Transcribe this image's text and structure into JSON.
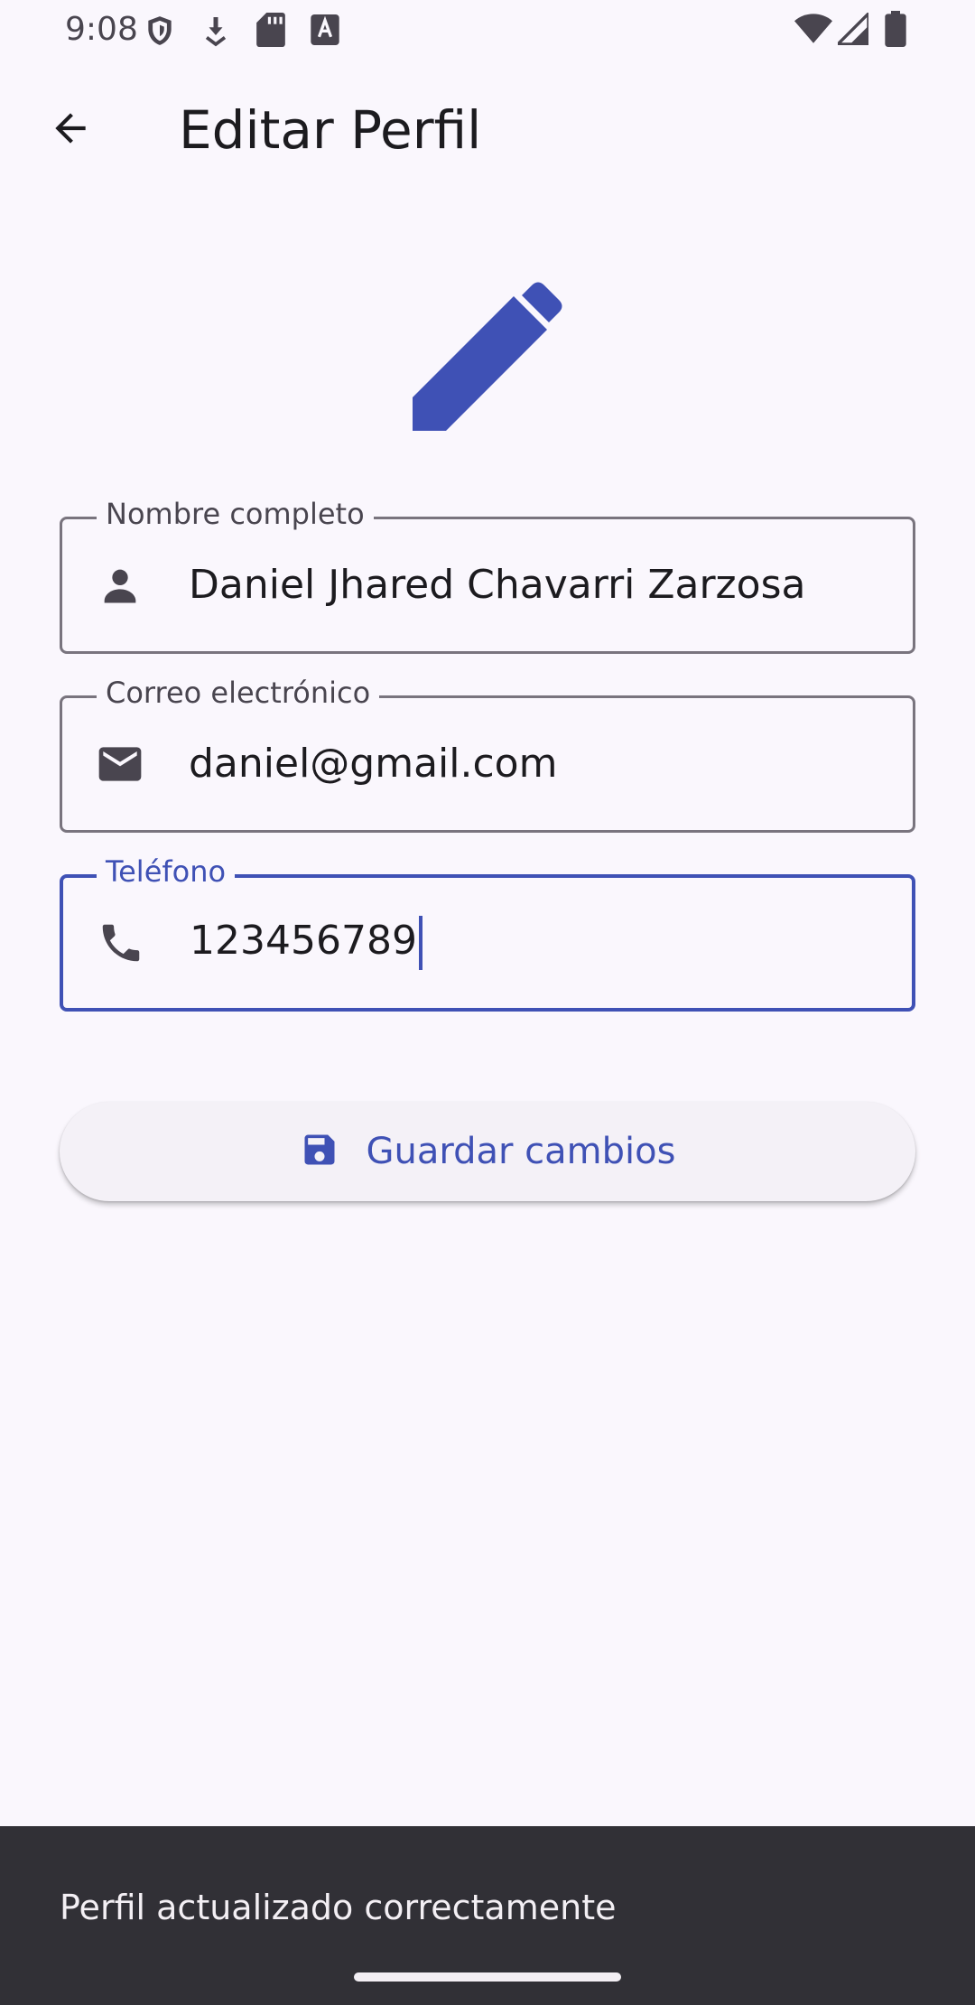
{
  "status_bar": {
    "time": "9:08",
    "left_icons": [
      "shield-icon",
      "download-icon",
      "sd-card-icon",
      "a-badge-icon"
    ],
    "right_icons": [
      "wifi-icon",
      "signal-icon",
      "battery-icon"
    ]
  },
  "app_bar": {
    "back_icon": "arrow-back-icon",
    "title": "Editar Perfil"
  },
  "header_icon": "edit-pencil-icon",
  "accent_color": "#3f51b5",
  "form": {
    "name": {
      "label": "Nombre completo",
      "value": "Daniel Jhared Chavarri Zarzosa",
      "icon": "person-icon"
    },
    "email": {
      "label": "Correo electrónico",
      "value": "daniel@gmail.com",
      "icon": "mail-icon"
    },
    "phone": {
      "label": "Teléfono",
      "value": "123456789",
      "icon": "phone-icon",
      "focused": true
    }
  },
  "save_button": {
    "label": "Guardar cambios",
    "icon": "save-icon"
  },
  "snackbar": {
    "message": "Perfil actualizado correctamente"
  }
}
